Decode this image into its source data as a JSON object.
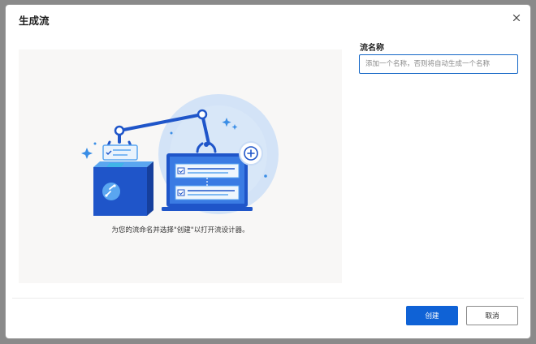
{
  "dialog": {
    "title": "生成流",
    "close_icon": "close-icon"
  },
  "illustration": {
    "caption": "为您的流命名并选择\"创建\"以打开流设计器。",
    "colors": {
      "panel_bg": "#f8f7f6",
      "circle": "#cfe0f7",
      "blue_dark": "#1f55c9",
      "blue_mid": "#3a7be3",
      "blue_light": "#5aa6f0",
      "accent_teal": "#40b4e8"
    }
  },
  "form": {
    "name_label": "流名称",
    "name_placeholder": "添加一个名称，否则将自动生成一个名称",
    "name_value": ""
  },
  "footer": {
    "create_label": "创建",
    "cancel_label": "取消"
  },
  "colors": {
    "primary": "#0f62d6",
    "input_border": "#1366c6",
    "text": "#1f1f1f"
  }
}
